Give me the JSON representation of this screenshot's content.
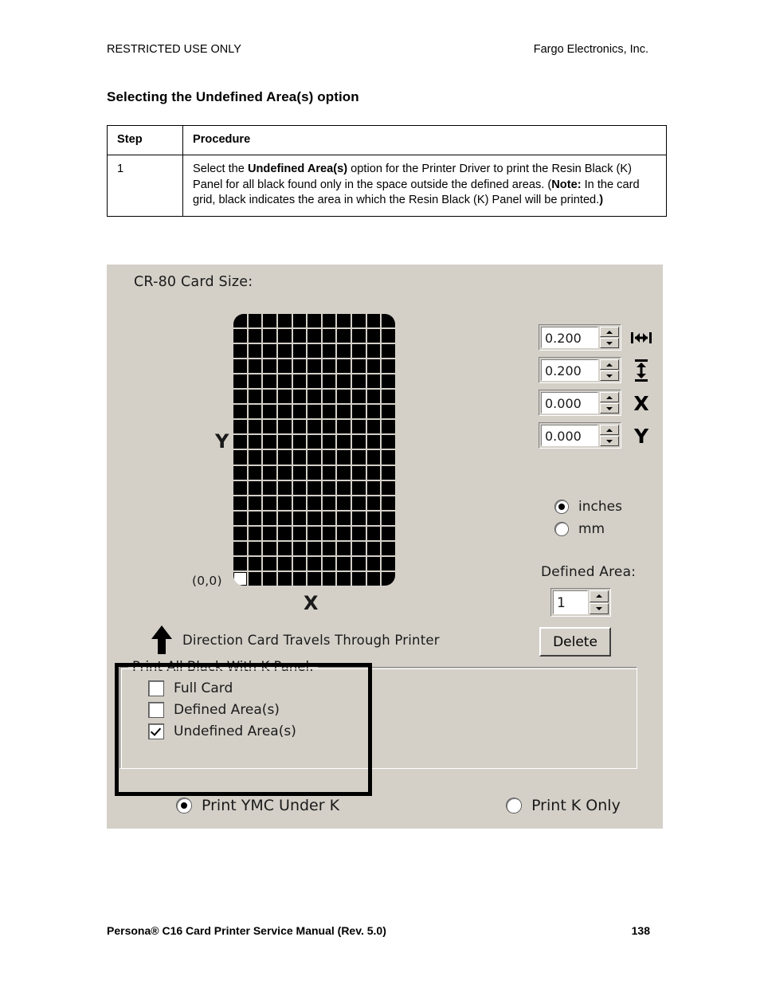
{
  "header": {
    "left": "RESTRICTED USE ONLY",
    "right": "Fargo Electronics, Inc."
  },
  "page_title": "Selecting the Undefined Area(s) option",
  "table": {
    "columns": [
      "Step",
      "Procedure"
    ],
    "rows": [
      {
        "step": "1",
        "procedure_parts": [
          {
            "text": "Select the ",
            "bold": false
          },
          {
            "text": "Undefined Area(s)",
            "bold": true
          },
          {
            "text": " option for the Printer Driver to print the Resin Black (K) Panel for all black found only in the space outside the defined areas. (",
            "bold": false
          },
          {
            "text": "Note:",
            "bold": true
          },
          {
            "text": " In the card grid, black indicates the area in which the Resin Black (K) Panel will be printed.",
            "bold": false
          },
          {
            "text": ")",
            "bold": true
          }
        ]
      }
    ]
  },
  "dialog": {
    "card_size_label": "CR-80 Card Size:",
    "grid": {
      "columns": 11,
      "rows": 18,
      "fill_color": "#000000",
      "origin_cell_color": "#ffffff",
      "origin_label": "(0,0)"
    },
    "axis_y_label": "Y",
    "axis_x_label": "X",
    "direction_text": "Direction Card Travels Through Printer",
    "spinners": [
      {
        "name": "width",
        "value": "0.200",
        "icon": "width-arrow-icon"
      },
      {
        "name": "height",
        "value": "0.200",
        "icon": "height-arrow-icon"
      },
      {
        "name": "x-offset",
        "value": "0.000",
        "icon": "x-axis-icon"
      },
      {
        "name": "y-offset",
        "value": "0.000",
        "icon": "y-axis-icon"
      }
    ],
    "units": {
      "options": [
        {
          "label": "inches",
          "selected": true
        },
        {
          "label": "mm",
          "selected": false
        }
      ]
    },
    "defined_area": {
      "label": "Defined Area:",
      "value": "1",
      "delete_label": "Delete"
    },
    "k_panel_group": {
      "legend": "Print All Black With K Panel:",
      "checkboxes": [
        {
          "label": "Full Card",
          "checked": false
        },
        {
          "label": "Defined Area(s)",
          "checked": false
        },
        {
          "label": "Undefined Area(s)",
          "checked": true
        }
      ]
    },
    "print_mode": {
      "options": [
        {
          "label": "Print YMC Under K",
          "selected": true
        },
        {
          "label": "Print K Only",
          "selected": false
        }
      ]
    },
    "colors": {
      "face": "#d4d0c8",
      "field": "#ffffff",
      "shadow": "#808080",
      "dark_shadow": "#404040",
      "annotation": "#000000"
    }
  },
  "footer": {
    "left": "Persona® C16 Card Printer Service Manual (Rev. 5.0)",
    "page_number": "138"
  }
}
